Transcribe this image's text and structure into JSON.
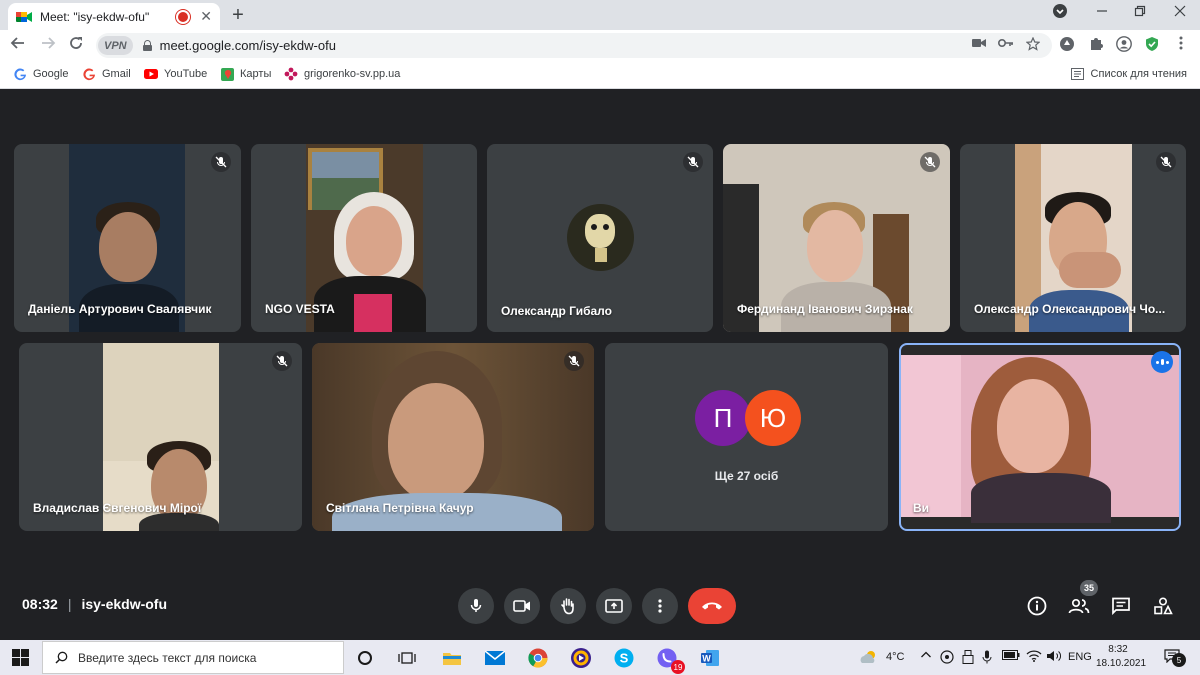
{
  "browser": {
    "tab_title": "Meet: \"isy-ekdw-ofu\"",
    "tab_close": "✕",
    "new_tab": "+",
    "url": "meet.google.com/isy-ekdw-ofu",
    "vpn_label": "VPN",
    "bookmarks": [
      {
        "label": "Google",
        "icon": "google-icon"
      },
      {
        "label": "Gmail",
        "icon": "google-icon"
      },
      {
        "label": "YouTube",
        "icon": "youtube-icon"
      },
      {
        "label": "Карты",
        "icon": "maps-icon"
      },
      {
        "label": "grigorenko-sv.pp.ua",
        "icon": "flower-icon"
      }
    ],
    "reading_list": "Список для чтения"
  },
  "meeting": {
    "participants": [
      {
        "name": "Даніель Артурович Свалявчик",
        "muted": true
      },
      {
        "name": "NGO VESTA",
        "muted": false
      },
      {
        "name": "Олександр Гибало",
        "muted": true
      },
      {
        "name": "Фердинанд Іванович Зирзнак",
        "muted": true
      },
      {
        "name": "Олександр Олександрович Чо...",
        "muted": true
      },
      {
        "name": "Владислав Євгенович Мірої",
        "muted": true
      },
      {
        "name": "Світлана Петрівна Качур",
        "muted": true
      }
    ],
    "others": {
      "letters": [
        "П",
        "Ю"
      ],
      "letter_colors": [
        "#7b1fa2",
        "#f4511e"
      ],
      "label": "Ще 27 осіб"
    },
    "self": {
      "name": "Ви",
      "speaking": true
    },
    "time": "08:32",
    "separator": "|",
    "meeting_code": "isy-ekdw-ofu",
    "people_count": "35",
    "colors": {
      "stage": "#202124",
      "tile": "#3c4043",
      "end_call": "#ea4335",
      "accent": "#1a73e8"
    }
  },
  "taskbar": {
    "search_placeholder": "Введите здесь текст для поиска",
    "temperature": "4°C",
    "language": "ENG",
    "clock_time": "8:32",
    "clock_date": "18.10.2021",
    "viber_badge": "19",
    "notification_count": "5"
  }
}
